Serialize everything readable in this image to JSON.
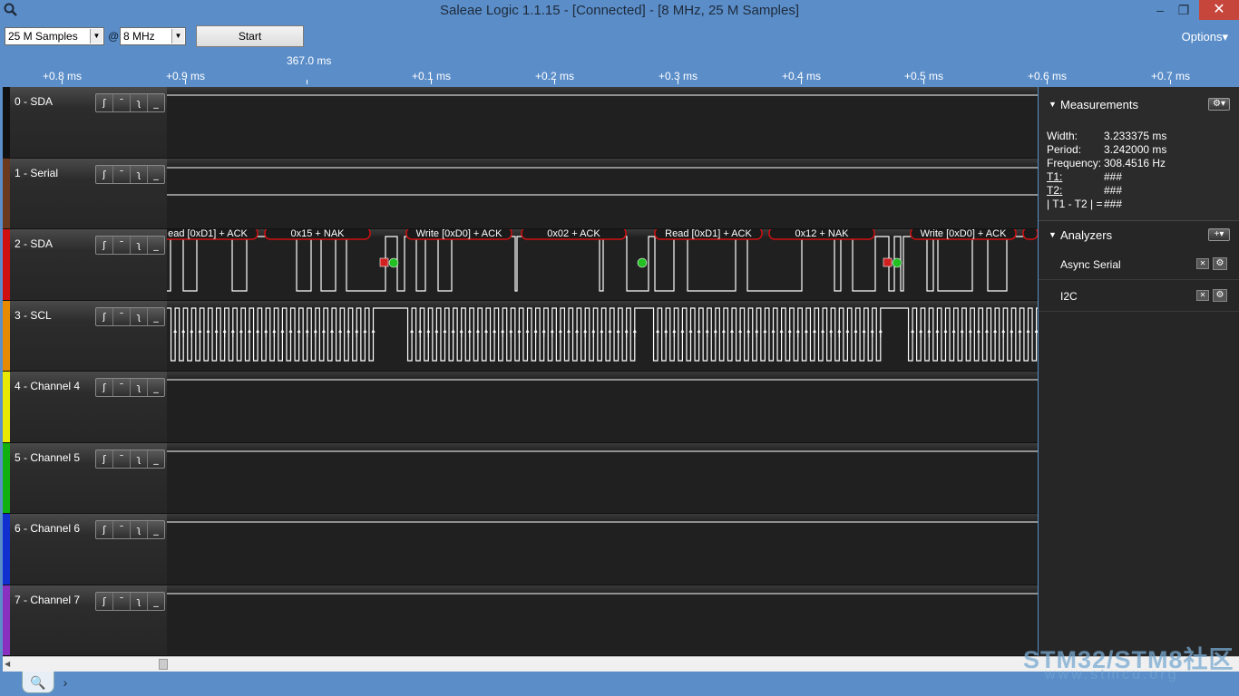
{
  "window": {
    "title": "Saleae Logic 1.1.15 - [Connected] - [8 MHz, 25 M Samples]",
    "minimize": "–",
    "maximize": "❐",
    "close": "✕"
  },
  "toolbar": {
    "samples_value": "25 M Samples",
    "at_sign": "@",
    "rate_value": "8 MHz",
    "start_label": "Start",
    "options_label": "Options▾"
  },
  "ruler": {
    "cursor_time": "367.0 ms",
    "ticks": [
      "+0.8 ms",
      "+0.9 ms",
      "+0.1 ms",
      "+0.2 ms",
      "+0.3 ms",
      "+0.4 ms",
      "+0.5 ms",
      "+0.6 ms",
      "+0.7 ms"
    ]
  },
  "channels": [
    {
      "name": "0 - SDA",
      "color": "#111111"
    },
    {
      "name": "1 - Serial",
      "color": "#6b3a1e"
    },
    {
      "name": "2 - SDA",
      "color": "#d01010"
    },
    {
      "name": "3 - SCL",
      "color": "#e88a00"
    },
    {
      "name": "4 - Channel 4",
      "color": "#e8e800"
    },
    {
      "name": "5 - Channel 5",
      "color": "#10b010"
    },
    {
      "name": "6 - Channel 6",
      "color": "#1030d0"
    },
    {
      "name": "7 - Channel 7",
      "color": "#8a30c0"
    }
  ],
  "trigger_icons": [
    "rising-edge-icon",
    "high-level-icon",
    "falling-edge-icon",
    "low-level-icon"
  ],
  "i2c_frames": [
    "ead [0xD1] + ACK",
    "0x15 + NAK",
    "Write [0xD0] + ACK",
    "0x02 + ACK",
    "Read [0xD1] + ACK",
    "0x12 + NAK",
    "Write [0xD0] + ACK"
  ],
  "measurements": {
    "title": "Measurements",
    "rows": [
      {
        "label": "Width:",
        "value": "3.233375 ms"
      },
      {
        "label": "Period:",
        "value": "3.242000 ms"
      },
      {
        "label": "Frequency:",
        "value": "308.4516 Hz"
      },
      {
        "label": "T1:",
        "value": "###"
      },
      {
        "label": "T2:",
        "value": "###"
      },
      {
        "label": "| T1 - T2 | =",
        "value": "###"
      }
    ]
  },
  "analyzers": {
    "title": "Analyzers",
    "add_label": "+▾",
    "items": [
      "Async Serial",
      "I2C"
    ]
  },
  "colors": {
    "chrome": "#5b8ec9",
    "frame_outline": "#d01010",
    "start_marker": "#22c022",
    "stop_marker": "#d02020"
  },
  "watermark": {
    "line1": "STM32/STM8社区",
    "line2": "www.stmcu.org"
  }
}
